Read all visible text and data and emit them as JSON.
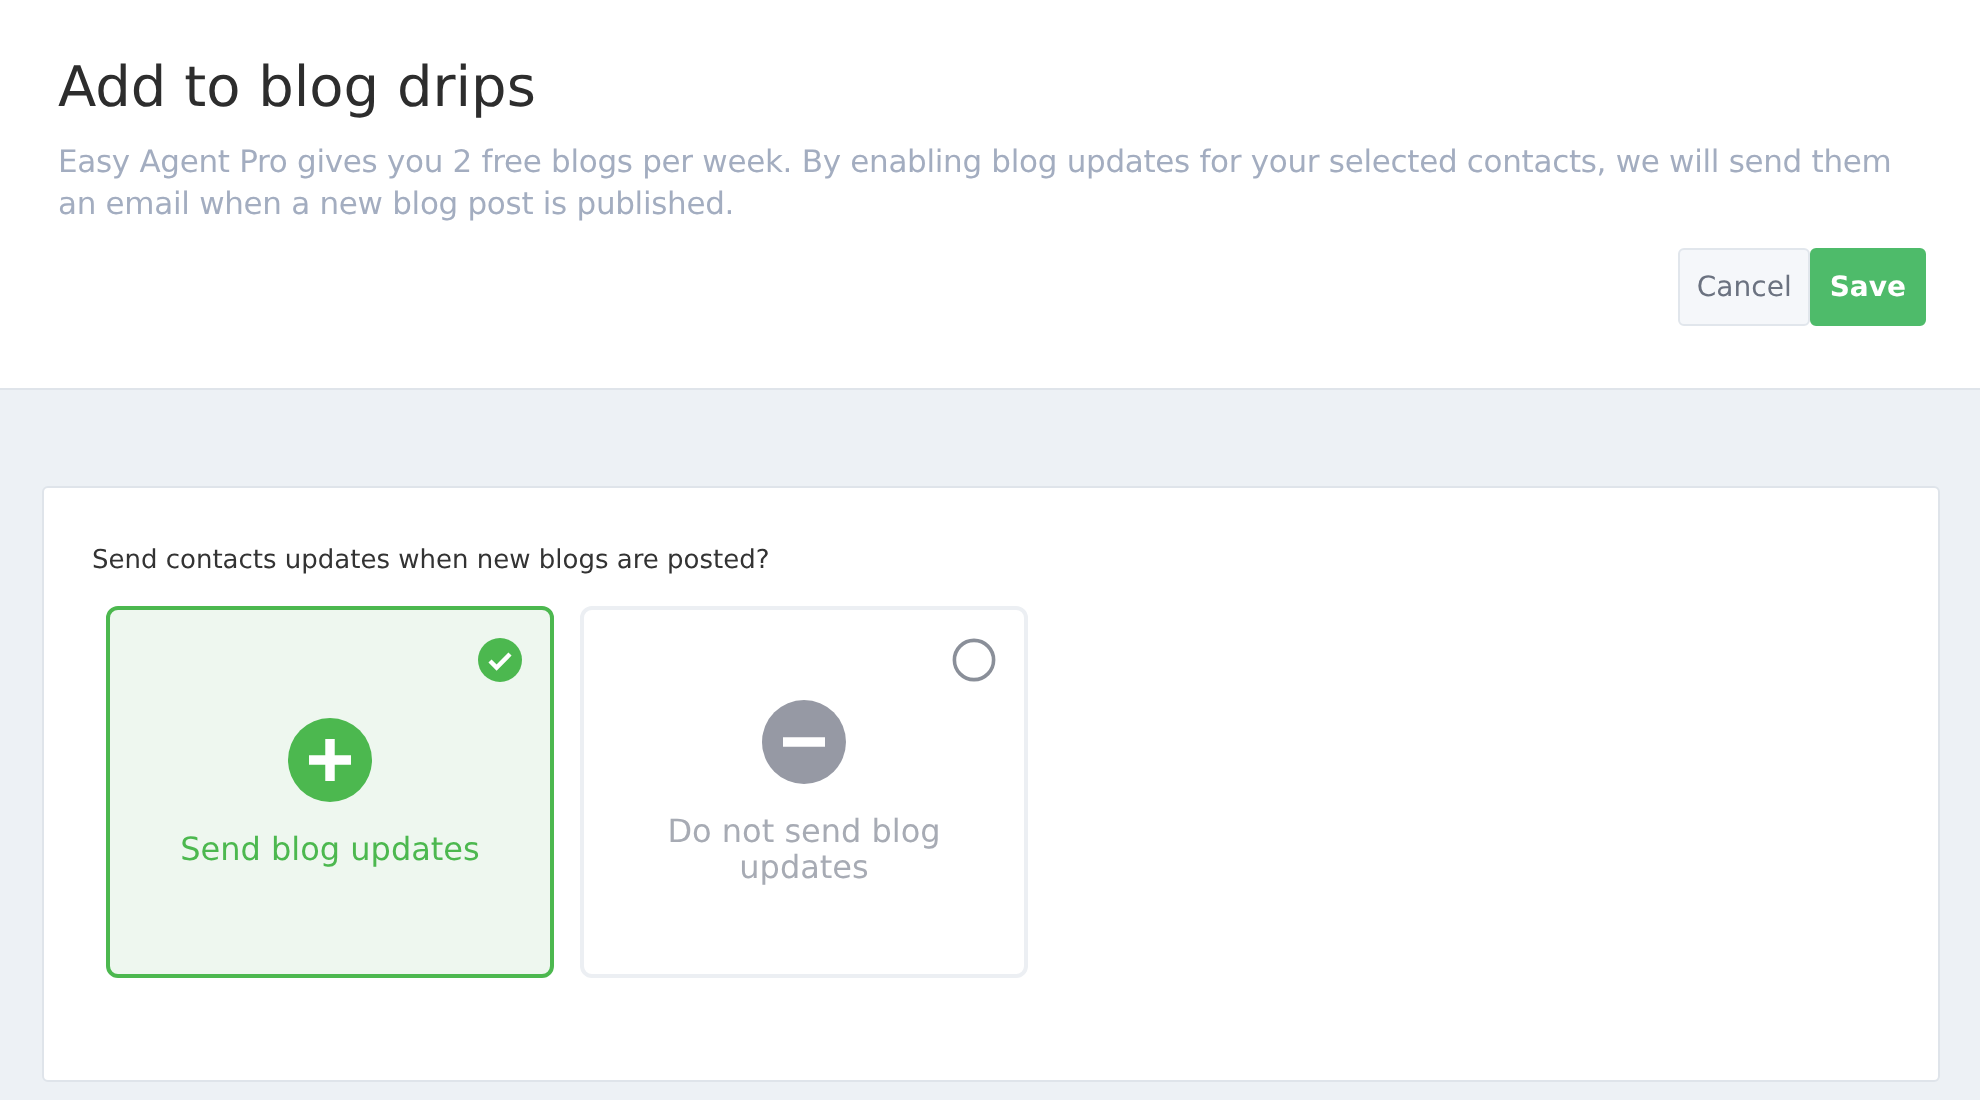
{
  "header": {
    "title": "Add to blog drips",
    "description": "Easy Agent Pro gives you 2 free blogs per week. By enabling blog updates for your selected contacts, we will send them an email when a new blog post is published.",
    "buttons": [
      {
        "label": "Cancel",
        "kind": "secondary"
      },
      {
        "label": "Save",
        "kind": "primary"
      }
    ]
  },
  "form": {
    "question": "Send contacts updates when new blogs are posted?",
    "options": [
      {
        "label": "Send blog updates",
        "kind": "add",
        "selected": true
      },
      {
        "label": "Do not send blog updates",
        "kind": "remove",
        "selected": false
      }
    ]
  }
}
